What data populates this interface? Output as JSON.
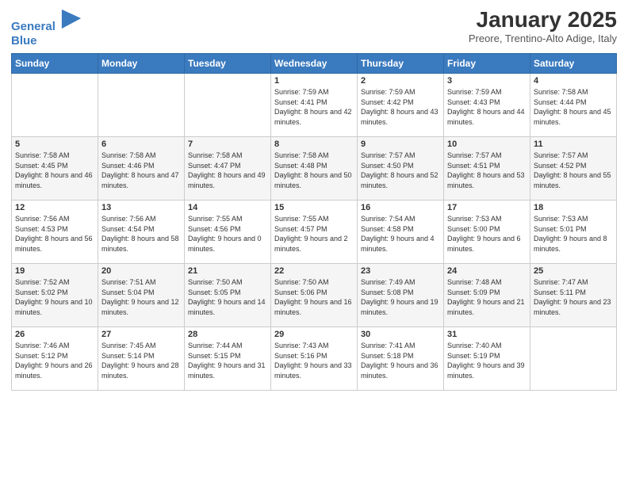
{
  "header": {
    "logo_line1": "General",
    "logo_line2": "Blue",
    "month": "January 2025",
    "location": "Preore, Trentino-Alto Adige, Italy"
  },
  "weekdays": [
    "Sunday",
    "Monday",
    "Tuesday",
    "Wednesday",
    "Thursday",
    "Friday",
    "Saturday"
  ],
  "weeks": [
    [
      {
        "day": "",
        "info": ""
      },
      {
        "day": "",
        "info": ""
      },
      {
        "day": "",
        "info": ""
      },
      {
        "day": "1",
        "info": "Sunrise: 7:59 AM\nSunset: 4:41 PM\nDaylight: 8 hours and 42 minutes."
      },
      {
        "day": "2",
        "info": "Sunrise: 7:59 AM\nSunset: 4:42 PM\nDaylight: 8 hours and 43 minutes."
      },
      {
        "day": "3",
        "info": "Sunrise: 7:59 AM\nSunset: 4:43 PM\nDaylight: 8 hours and 44 minutes."
      },
      {
        "day": "4",
        "info": "Sunrise: 7:58 AM\nSunset: 4:44 PM\nDaylight: 8 hours and 45 minutes."
      }
    ],
    [
      {
        "day": "5",
        "info": "Sunrise: 7:58 AM\nSunset: 4:45 PM\nDaylight: 8 hours and 46 minutes."
      },
      {
        "day": "6",
        "info": "Sunrise: 7:58 AM\nSunset: 4:46 PM\nDaylight: 8 hours and 47 minutes."
      },
      {
        "day": "7",
        "info": "Sunrise: 7:58 AM\nSunset: 4:47 PM\nDaylight: 8 hours and 49 minutes."
      },
      {
        "day": "8",
        "info": "Sunrise: 7:58 AM\nSunset: 4:48 PM\nDaylight: 8 hours and 50 minutes."
      },
      {
        "day": "9",
        "info": "Sunrise: 7:57 AM\nSunset: 4:50 PM\nDaylight: 8 hours and 52 minutes."
      },
      {
        "day": "10",
        "info": "Sunrise: 7:57 AM\nSunset: 4:51 PM\nDaylight: 8 hours and 53 minutes."
      },
      {
        "day": "11",
        "info": "Sunrise: 7:57 AM\nSunset: 4:52 PM\nDaylight: 8 hours and 55 minutes."
      }
    ],
    [
      {
        "day": "12",
        "info": "Sunrise: 7:56 AM\nSunset: 4:53 PM\nDaylight: 8 hours and 56 minutes."
      },
      {
        "day": "13",
        "info": "Sunrise: 7:56 AM\nSunset: 4:54 PM\nDaylight: 8 hours and 58 minutes."
      },
      {
        "day": "14",
        "info": "Sunrise: 7:55 AM\nSunset: 4:56 PM\nDaylight: 9 hours and 0 minutes."
      },
      {
        "day": "15",
        "info": "Sunrise: 7:55 AM\nSunset: 4:57 PM\nDaylight: 9 hours and 2 minutes."
      },
      {
        "day": "16",
        "info": "Sunrise: 7:54 AM\nSunset: 4:58 PM\nDaylight: 9 hours and 4 minutes."
      },
      {
        "day": "17",
        "info": "Sunrise: 7:53 AM\nSunset: 5:00 PM\nDaylight: 9 hours and 6 minutes."
      },
      {
        "day": "18",
        "info": "Sunrise: 7:53 AM\nSunset: 5:01 PM\nDaylight: 9 hours and 8 minutes."
      }
    ],
    [
      {
        "day": "19",
        "info": "Sunrise: 7:52 AM\nSunset: 5:02 PM\nDaylight: 9 hours and 10 minutes."
      },
      {
        "day": "20",
        "info": "Sunrise: 7:51 AM\nSunset: 5:04 PM\nDaylight: 9 hours and 12 minutes."
      },
      {
        "day": "21",
        "info": "Sunrise: 7:50 AM\nSunset: 5:05 PM\nDaylight: 9 hours and 14 minutes."
      },
      {
        "day": "22",
        "info": "Sunrise: 7:50 AM\nSunset: 5:06 PM\nDaylight: 9 hours and 16 minutes."
      },
      {
        "day": "23",
        "info": "Sunrise: 7:49 AM\nSunset: 5:08 PM\nDaylight: 9 hours and 19 minutes."
      },
      {
        "day": "24",
        "info": "Sunrise: 7:48 AM\nSunset: 5:09 PM\nDaylight: 9 hours and 21 minutes."
      },
      {
        "day": "25",
        "info": "Sunrise: 7:47 AM\nSunset: 5:11 PM\nDaylight: 9 hours and 23 minutes."
      }
    ],
    [
      {
        "day": "26",
        "info": "Sunrise: 7:46 AM\nSunset: 5:12 PM\nDaylight: 9 hours and 26 minutes."
      },
      {
        "day": "27",
        "info": "Sunrise: 7:45 AM\nSunset: 5:14 PM\nDaylight: 9 hours and 28 minutes."
      },
      {
        "day": "28",
        "info": "Sunrise: 7:44 AM\nSunset: 5:15 PM\nDaylight: 9 hours and 31 minutes."
      },
      {
        "day": "29",
        "info": "Sunrise: 7:43 AM\nSunset: 5:16 PM\nDaylight: 9 hours and 33 minutes."
      },
      {
        "day": "30",
        "info": "Sunrise: 7:41 AM\nSunset: 5:18 PM\nDaylight: 9 hours and 36 minutes."
      },
      {
        "day": "31",
        "info": "Sunrise: 7:40 AM\nSunset: 5:19 PM\nDaylight: 9 hours and 39 minutes."
      },
      {
        "day": "",
        "info": ""
      }
    ]
  ]
}
